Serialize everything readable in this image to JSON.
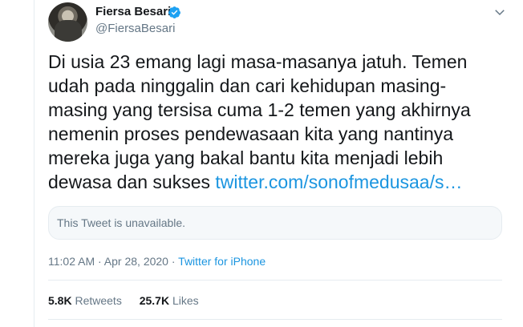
{
  "author": {
    "name": "Fiersa Besari",
    "handle": "@FiersaBesari",
    "avatar_icon": "user-avatar",
    "verified_icon": "verified-badge-icon"
  },
  "tweet": {
    "text_lines": [
      "Di usia 23 emang lagi masa-masanya jatuh. Temen",
      "udah pada ninggalin dan cari kehidupan masing-",
      "masing yang tersisa cuma 1-2 temen yang akhirnya",
      "nemenin proses pendewasaan kita yang nantinya",
      "mereka juga yang bakal bantu kita menjadi lebih",
      "dewasa dan sukses "
    ],
    "link": "twitter.com/sonofmedusaa/s…",
    "quoted_unavailable": "This Tweet is unavailable.",
    "time": "11:02 AM",
    "separator": " · ",
    "date": "Apr 28, 2020",
    "source": "Twitter for iPhone"
  },
  "stats": {
    "retweets_count": "5.8K",
    "retweets_label": " Retweets",
    "likes_count": "25.7K",
    "likes_label": " Likes"
  },
  "colors": {
    "link": "#1b95e0",
    "secondary_text": "#657786",
    "border": "#e6ecf0"
  }
}
